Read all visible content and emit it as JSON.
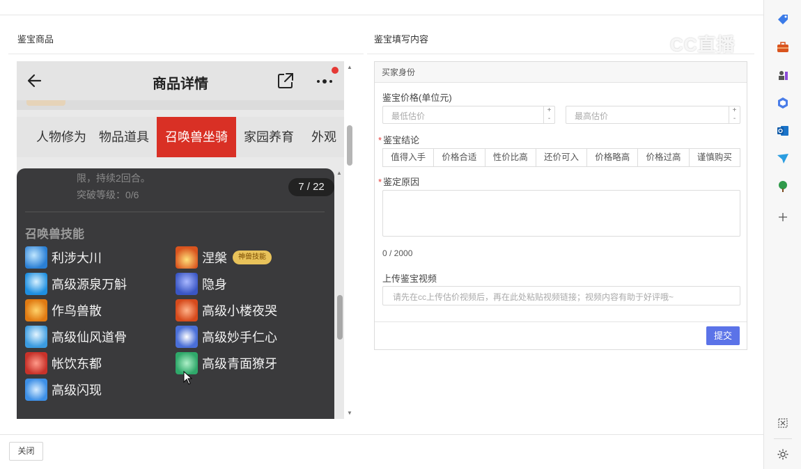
{
  "left": {
    "section_title": "鉴宝商品",
    "phone": {
      "title": "商品详情",
      "tabs": [
        "人物修为",
        "物品道具",
        "召唤兽坐骑",
        "家园养育",
        "外观"
      ],
      "active_tab": "召唤兽坐骑",
      "faded_line1": "限，持续2回合。",
      "faded_line2": "突破等级：0/6",
      "counter": "7 / 22",
      "skills_heading": "召唤兽技能",
      "skills": [
        {
          "name": "利涉大川",
          "icon": "water-swirl-icon",
          "color": "#2a7fd4"
        },
        {
          "name": "涅槃",
          "icon": "phoenix-fire-icon",
          "color": "#d9541e",
          "badge": "神兽技能"
        },
        {
          "name": "高级源泉万斛",
          "icon": "fountain-icon",
          "color": "#1e8fe0"
        },
        {
          "name": "隐身",
          "icon": "stealth-icon",
          "color": "#3a56c4"
        },
        {
          "name": "作鸟兽散",
          "icon": "scatter-fire-icon",
          "color": "#e07a12"
        },
        {
          "name": "高级小楼夜哭",
          "icon": "night-weep-icon",
          "color": "#d64a1c"
        },
        {
          "name": "高级仙风道骨",
          "icon": "immortal-icon",
          "color": "#3b9be0"
        },
        {
          "name": "高级妙手仁心",
          "icon": "healing-hand-icon",
          "color": "#4a6fd8"
        },
        {
          "name": "帐饮东都",
          "icon": "banquet-icon",
          "color": "#c8322a"
        },
        {
          "name": "高级青面獠牙",
          "icon": "fang-mask-icon",
          "color": "#2fa86a"
        },
        {
          "name": "高级闪现",
          "icon": "flash-icon",
          "color": "#3d8fe6"
        }
      ]
    }
  },
  "right": {
    "section_title": "鉴宝填写内容",
    "panel_title": "买家身份",
    "price_label": "鉴宝价格(单位元)",
    "min_placeholder": "最低估价",
    "max_placeholder": "最高估价",
    "conclusion_label": "鉴宝结论",
    "conclusions": [
      "值得入手",
      "价格合适",
      "性价比高",
      "还价可入",
      "价格略高",
      "价格过高",
      "谨慎购买"
    ],
    "reason_label": "鉴定原因",
    "reason_counter": "0 / 2000",
    "video_label": "上传鉴宝视频",
    "video_placeholder": "请先在cc上传估价视频后，再在此处粘贴视频链接；视频内容有助于好评哦~",
    "submit": "提交"
  },
  "footer": {
    "close": "关闭"
  },
  "watermark": "CC直播",
  "sidebar_icons": [
    "tag-icon",
    "briefcase-icon",
    "chess-icon",
    "copilot-icon",
    "outlook-icon",
    "send-icon",
    "tree-icon",
    "plus-icon",
    "screenshot-icon",
    "gear-icon"
  ]
}
